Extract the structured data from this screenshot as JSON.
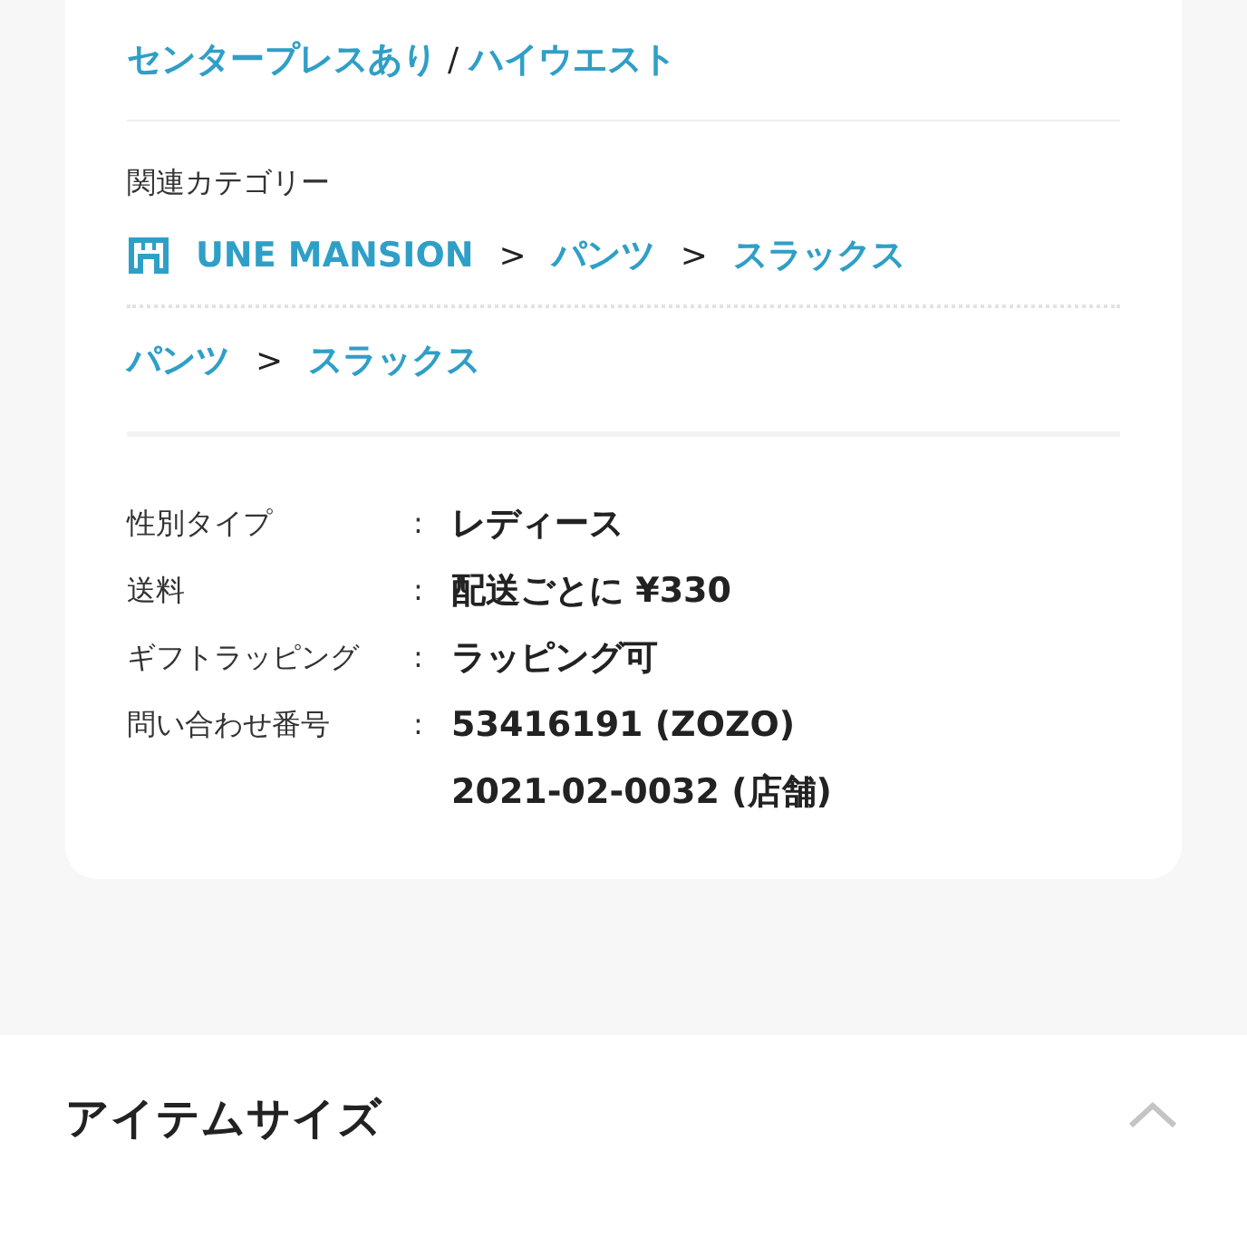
{
  "tags": {
    "items": [
      "センタープレスあり",
      "ハイウエスト"
    ],
    "separator": "/"
  },
  "related_categories": {
    "label": "関連カテゴリー",
    "paths": [
      {
        "kind": "shop",
        "items": [
          {
            "kind": "link",
            "text": "UNE MANSION"
          },
          {
            "kind": "separator",
            "text": ">"
          },
          {
            "kind": "link",
            "text": "パンツ"
          },
          {
            "kind": "separator",
            "text": ">"
          },
          {
            "kind": "link",
            "text": "スラックス"
          }
        ]
      },
      {
        "kind": "plain",
        "items": [
          {
            "kind": "link",
            "text": "パンツ"
          },
          {
            "kind": "separator",
            "text": ">"
          },
          {
            "kind": "link",
            "text": "スラックス"
          }
        ]
      }
    ]
  },
  "specs": [
    {
      "label": "性別タイプ",
      "colon": ":",
      "values": [
        "レディース"
      ]
    },
    {
      "label": "送料",
      "colon": ":",
      "values": [
        "配送ごとに ¥330"
      ]
    },
    {
      "label": "ギフトラッピング",
      "colon": ":",
      "values": [
        "ラッピング可"
      ]
    },
    {
      "label": "問い合わせ番号",
      "colon": ":",
      "values": [
        "53416191 (ZOZO)",
        "2021-02-0032 (店舗)"
      ]
    }
  ],
  "section": {
    "title": "アイテムサイズ",
    "expanded": true
  }
}
